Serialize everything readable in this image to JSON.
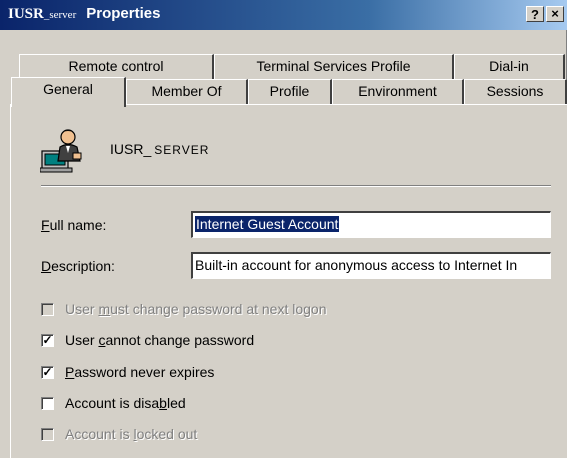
{
  "window": {
    "title_main": "IUSR",
    "title_sub": "_server",
    "title_rest": "Properties",
    "help_label": "?",
    "close_label": "×"
  },
  "tabs_row1": [
    {
      "label": "Remote control"
    },
    {
      "label": "Terminal Services Profile"
    },
    {
      "label": "Dial-in"
    }
  ],
  "tabs_row2": [
    {
      "label": "General",
      "active": true
    },
    {
      "label": "Member Of"
    },
    {
      "label": "Profile"
    },
    {
      "label": "Environment"
    },
    {
      "label": "Sessions"
    }
  ],
  "general": {
    "icon": "user-computer-icon",
    "username_prefix": "IUSR_",
    "username_suffix": "SERVER",
    "full_name_label": "Full name:",
    "full_name_value": "Internet Guest Account",
    "description_label": "Description:",
    "description_value": "Built-in account for anonymous access to Internet In",
    "checkboxes": [
      {
        "label": "User must change password at next logon",
        "checked": false,
        "disabled": true
      },
      {
        "label": "User cannot change password",
        "checked": true,
        "disabled": false
      },
      {
        "label": "Password never expires",
        "checked": true,
        "disabled": false
      },
      {
        "label": "Account is disabled",
        "checked": false,
        "disabled": false
      },
      {
        "label": "Account is locked out",
        "checked": false,
        "disabled": true
      }
    ]
  },
  "colors": {
    "titlebar_start": "#0a246a",
    "titlebar_end": "#a6caf0",
    "dialog_face": "#d4d0c8",
    "selection": "#0a246a"
  }
}
